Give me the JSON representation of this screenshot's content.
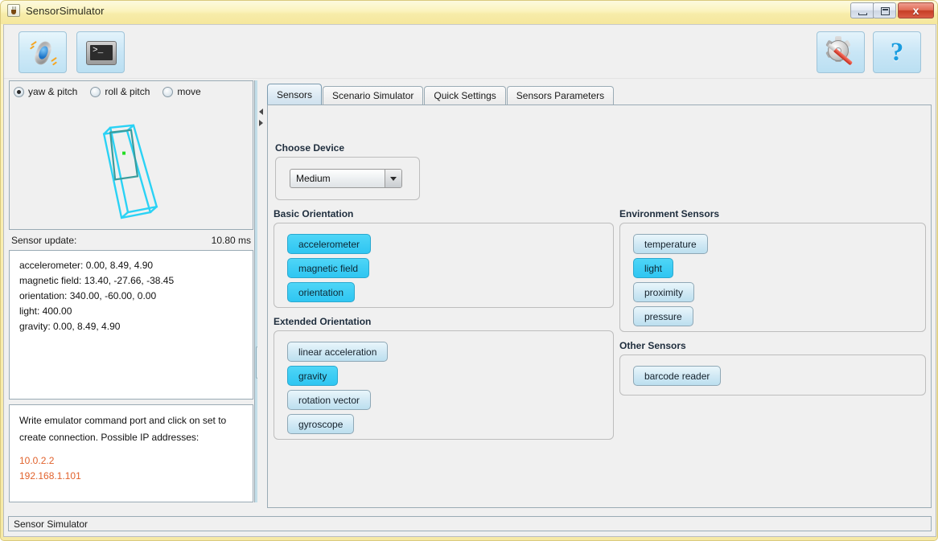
{
  "window": {
    "title": "SensorSimulator",
    "app_icon": "java-coffee-icon",
    "minimize_label": "–",
    "maximize_label": "□",
    "close_label": "x"
  },
  "toolbar": {
    "buttons": [
      {
        "name": "sensor-simulator-button",
        "icon": "phone-shake-icon",
        "active": true
      },
      {
        "name": "terminal-button",
        "icon": "terminal-icon",
        "active": false
      },
      {
        "name": "settings-button",
        "icon": "gear-screwdriver-icon",
        "active": false
      },
      {
        "name": "help-button",
        "icon": "question-mark-icon",
        "label": "?",
        "active": false
      }
    ]
  },
  "left_panel": {
    "view_modes": [
      {
        "label": "yaw & pitch",
        "selected": true
      },
      {
        "label": "roll & pitch",
        "selected": false
      },
      {
        "label": "move",
        "selected": false
      }
    ],
    "visualization": {
      "name": "phone-3d-wireframe",
      "wire_color": "#2ad2f5",
      "screen_color": "#3a9c9c",
      "center_dot_color": "#22dd22"
    },
    "sensor_update": {
      "label": "Sensor update:",
      "value": "10.80 ms"
    },
    "readings": [
      "accelerometer: 0.00, 8.49, 4.90",
      "magnetic field: 13.40, -27.66, -38.45",
      "orientation: 340.00, -60.00, 0.00",
      "light: 400.00",
      "gravity: 0.00, 8.49, 4.90"
    ],
    "info": {
      "lines": [
        "Write emulator command port and click on set to",
        "create connection. Possible IP addresses:"
      ],
      "ip_addresses": [
        "10.0.2.2",
        "192.168.1.101"
      ],
      "ip_color": "#e1622c"
    }
  },
  "tabs": [
    {
      "label": "Sensors",
      "active": true
    },
    {
      "label": "Scenario Simulator",
      "active": false
    },
    {
      "label": "Quick Settings",
      "active": false
    },
    {
      "label": "Sensors Parameters",
      "active": false
    }
  ],
  "sensors_tab": {
    "choose_device": {
      "title": "Choose Device",
      "selected": "Medium"
    },
    "groups": [
      {
        "title": "Basic Orientation",
        "sensors": [
          {
            "label": "accelerometer",
            "active": true
          },
          {
            "label": "magnetic field",
            "active": true
          },
          {
            "label": "orientation",
            "active": true
          }
        ]
      },
      {
        "title": "Extended Orientation",
        "sensors": [
          {
            "label": "linear acceleration",
            "active": false
          },
          {
            "label": "gravity",
            "active": true
          },
          {
            "label": "rotation vector",
            "active": false
          },
          {
            "label": "gyroscope",
            "active": false
          }
        ]
      },
      {
        "title": "Environment Sensors",
        "sensors": [
          {
            "label": "temperature",
            "active": false
          },
          {
            "label": "light",
            "active": true
          },
          {
            "label": "proximity",
            "active": false
          },
          {
            "label": "pressure",
            "active": false
          }
        ]
      },
      {
        "title": "Other Sensors",
        "sensors": [
          {
            "label": "barcode reader",
            "active": false
          }
        ]
      }
    ]
  },
  "statusbar": {
    "text": "Sensor Simulator"
  },
  "colors": {
    "active_sensor": "#3ecdf4",
    "inactive_sensor": "#cfe8f4",
    "titlebar": "#f7ecaa",
    "panel_bg": "#f0f0f0"
  }
}
